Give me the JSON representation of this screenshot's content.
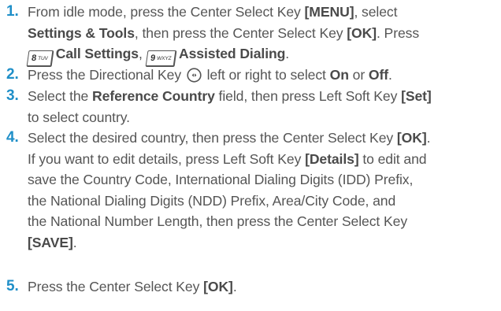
{
  "steps": [
    {
      "num": "1.",
      "parts": {
        "a": "From idle mode, press the Center Select Key ",
        "b": "[MENU]",
        "c": ", select",
        "d": "Settings & Tools",
        "e": ", then press the Center Select Key ",
        "f": "[OK]",
        "g": ". Press",
        "key1_main": "8",
        "key1_sub": "TUV",
        "h": "Call Settings",
        "i": ", ",
        "key2_main": "9",
        "key2_sub": "WXYZ",
        "j": "Assisted Dialing",
        "k": "."
      }
    },
    {
      "num": "2.",
      "parts": {
        "a": "Press the Directional Key ",
        "nav_icon": "directional-key-icon",
        "b": " left or right to select ",
        "c": "On",
        "d": " or ",
        "e": "Off",
        "f": "."
      }
    },
    {
      "num": "3.",
      "parts": {
        "a": "Select the ",
        "b": "Reference Country",
        "c": " field, then press Left Soft Key ",
        "d": "[Set]",
        "e": "to select country."
      }
    },
    {
      "num": "4.",
      "parts": {
        "a": "Select the desired country, then press the Center Select Key ",
        "b": "[OK]",
        "c": ".",
        "d": "If you want to edit details, press Left Soft Key ",
        "e": "[Details]",
        "f": " to edit and",
        "g": "save the Country Code, International Dialing Digits (IDD) Prefix,",
        "h": "the National Dialing Digits (NDD) Prefix, Area/City Code, and",
        "i": "the National Number Length, then press the Center Select Key",
        "j": "[SAVE]",
        "k": "."
      }
    },
    {
      "num": "5.",
      "parts": {
        "a": "Press the Center Select Key ",
        "b": "[OK]",
        "c": "."
      }
    }
  ],
  "colors": {
    "step_number": "#1f8fc8",
    "body_text": "#555555"
  }
}
